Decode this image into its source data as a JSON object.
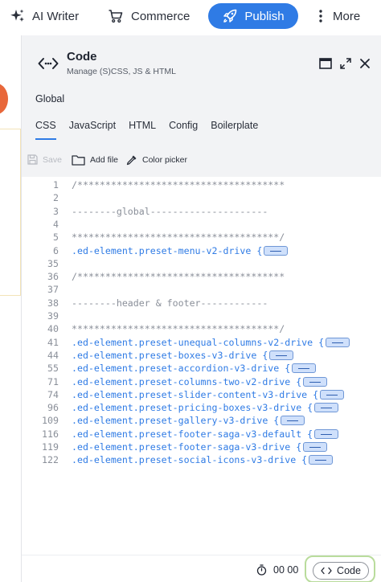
{
  "topbar": {
    "ai_writer": "AI Writer",
    "commerce": "Commerce",
    "publish": "Publish",
    "more": "More"
  },
  "panel": {
    "title": "Code",
    "subtitle": "Manage (S)CSS, JS & HTML",
    "section": "Global",
    "tabs": [
      "CSS",
      "JavaScript",
      "HTML",
      "Config",
      "Boilerplate"
    ],
    "active_tab": "CSS",
    "toolbar": {
      "save": "Save",
      "add_file": "Add file",
      "color_picker": "Color picker"
    }
  },
  "editor": {
    "lines": [
      {
        "n": "1",
        "text": "/*************************************",
        "sel": false,
        "fold": false
      },
      {
        "n": "2",
        "text": "",
        "sel": false,
        "fold": false
      },
      {
        "n": "3",
        "text": "--------global---------------------",
        "sel": false,
        "fold": false
      },
      {
        "n": "4",
        "text": "",
        "sel": false,
        "fold": false
      },
      {
        "n": "5",
        "text": "*************************************/",
        "sel": false,
        "fold": false
      },
      {
        "n": "6",
        "text": ".ed-element.preset-menu-v2-drive {",
        "sel": true,
        "fold": true
      },
      {
        "n": "35",
        "text": "",
        "sel": false,
        "fold": false
      },
      {
        "n": "36",
        "text": "/*************************************",
        "sel": false,
        "fold": false
      },
      {
        "n": "37",
        "text": "",
        "sel": false,
        "fold": false
      },
      {
        "n": "38",
        "text": "--------header & footer------------",
        "sel": false,
        "fold": false
      },
      {
        "n": "39",
        "text": "",
        "sel": false,
        "fold": false
      },
      {
        "n": "40",
        "text": "*************************************/",
        "sel": false,
        "fold": false
      },
      {
        "n": "41",
        "text": ".ed-element.preset-unequal-columns-v2-drive {",
        "sel": true,
        "fold": true
      },
      {
        "n": "44",
        "text": ".ed-element.preset-boxes-v3-drive {",
        "sel": true,
        "fold": true
      },
      {
        "n": "55",
        "text": ".ed-element.preset-accordion-v3-drive {",
        "sel": true,
        "fold": true
      },
      {
        "n": "71",
        "text": ".ed-element.preset-columns-two-v2-drive {",
        "sel": true,
        "fold": true
      },
      {
        "n": "74",
        "text": ".ed-element.preset-slider-content-v3-drive {",
        "sel": true,
        "fold": true
      },
      {
        "n": "96",
        "text": ".ed-element.preset-pricing-boxes-v3-drive {",
        "sel": true,
        "fold": true
      },
      {
        "n": "109",
        "text": ".ed-element.preset-gallery-v3-drive {",
        "sel": true,
        "fold": true
      },
      {
        "n": "116",
        "text": ".ed-element.preset-footer-saga-v3-default {",
        "sel": true,
        "fold": true
      },
      {
        "n": "119",
        "text": ".ed-element.preset-footer-saga-v3-drive {",
        "sel": true,
        "fold": true
      },
      {
        "n": "122",
        "text": ".ed-element.preset-social-icons-v3-drive {",
        "sel": true,
        "fold": true
      }
    ]
  },
  "status": {
    "timer": "00 00",
    "code_toggle": "Code"
  },
  "colors": {
    "accent": "#2f7be5",
    "highlight_border": "#b9dc9c",
    "background_accent": "#e8673a"
  }
}
